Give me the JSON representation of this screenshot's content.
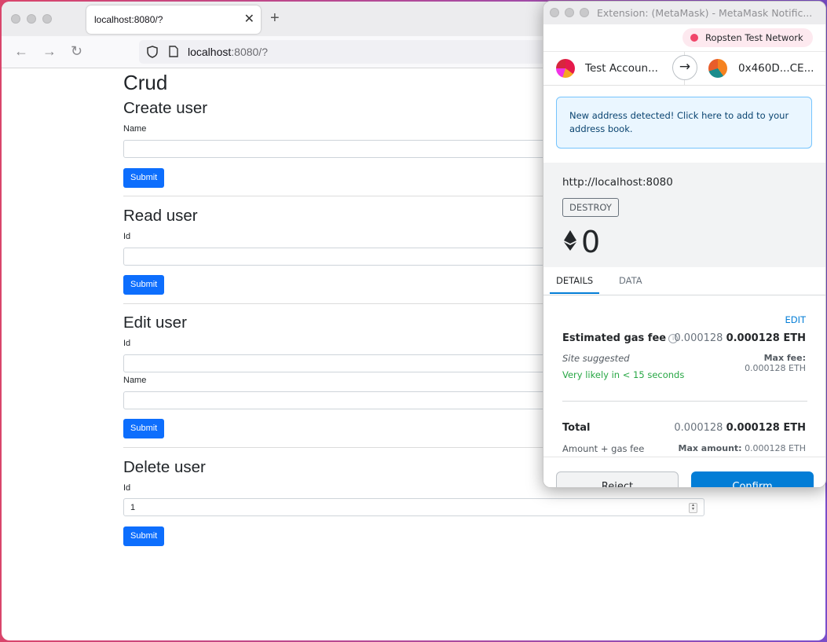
{
  "browser": {
    "tab_title": "localhost:8080/?",
    "url_host": "localhost",
    "url_rest": ":8080/?"
  },
  "page": {
    "title": "Crud",
    "sections": {
      "create": {
        "heading": "Create user",
        "name_label": "Name",
        "submit": "Submit"
      },
      "read": {
        "heading": "Read user",
        "id_label": "Id",
        "submit": "Submit"
      },
      "edit": {
        "heading": "Edit user",
        "id_label": "Id",
        "name_label": "Name",
        "submit": "Submit"
      },
      "delete": {
        "heading": "Delete user",
        "id_label": "Id",
        "id_value": "1",
        "submit": "Submit"
      }
    }
  },
  "metamask": {
    "window_title": "Extension: (MetaMask) - MetaMask Notific...",
    "network": "Ropsten Test Network",
    "from_account": "Test Accoun...",
    "to_account": "0x460D...CE...",
    "notice": "New address detected! Click here to add to your address book.",
    "origin": "http://localhost:8080",
    "method": "DESTROY",
    "amount": "0",
    "tabs": [
      "DETAILS",
      "DATA"
    ],
    "edit_label": "EDIT",
    "gas": {
      "label": "Estimated gas fee",
      "value_muted": "0.000128",
      "value_bold": "0.000128 ETH",
      "site_suggested": "Site suggested",
      "likelihood": "Very likely in < 15 seconds",
      "max_fee_label": "Max fee:",
      "max_fee_value": "0.000128 ETH"
    },
    "total": {
      "label": "Total",
      "value_muted": "0.000128",
      "value_bold": "0.000128 ETH",
      "sub_label": "Amount + gas fee",
      "max_amount_label": "Max amount:",
      "max_amount_value": "0.000128 ETH"
    },
    "reject": "Reject",
    "confirm": "Confirm",
    "colors": {
      "accent": "#037dd6",
      "network_dot": "#f0466a",
      "success": "#28a745"
    }
  }
}
